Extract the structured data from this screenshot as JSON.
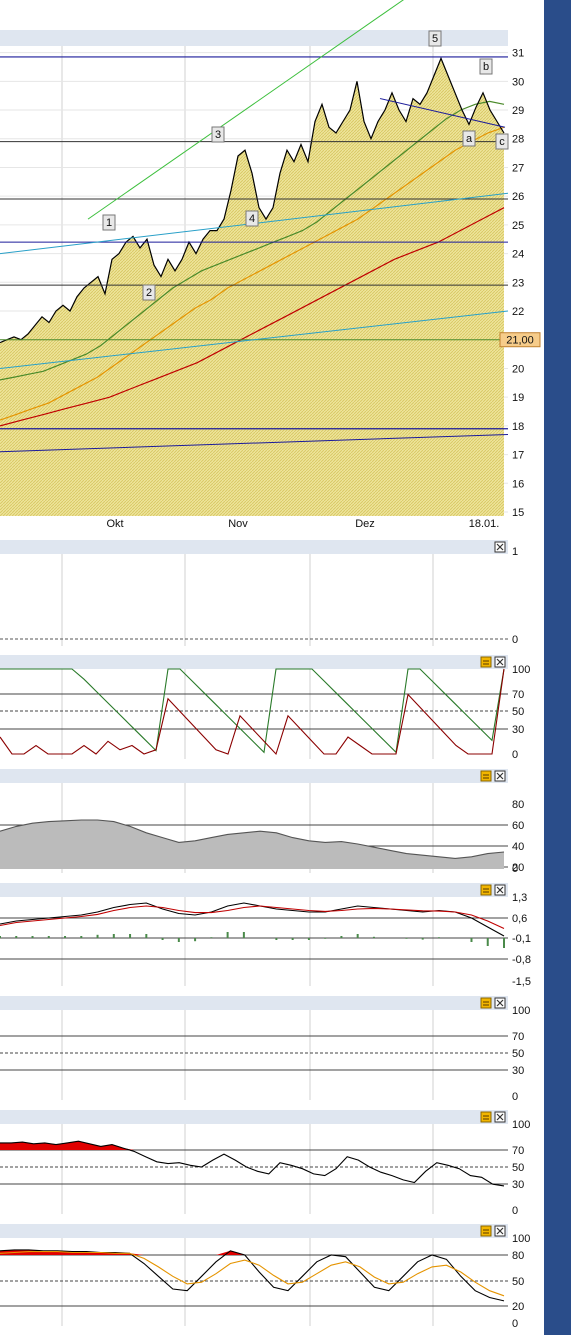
{
  "chart_data": [
    {
      "type": "line",
      "panel": "price",
      "x_labels": [
        "Okt",
        "Nov",
        "Dez",
        "18.01."
      ],
      "y_ticks": [
        15,
        16,
        17,
        18,
        19,
        20,
        21,
        22,
        23,
        24,
        25,
        26,
        27,
        28,
        29,
        30,
        31
      ],
      "ylim": [
        15,
        31.3
      ],
      "last_price_label": "21,00",
      "wave_labels": [
        "1",
        "2",
        "3",
        "4",
        "5",
        "a",
        "b",
        "c"
      ],
      "series": [
        {
          "values": [
            20.9,
            21.0,
            21.1,
            21.0,
            21.2,
            21.5,
            21.8,
            21.6,
            22.0,
            22.2,
            22.0,
            22.5,
            22.8,
            23.0,
            23.2,
            22.6,
            23.8,
            24.0,
            24.4,
            24.6,
            24.2,
            24.5,
            23.6,
            23.2,
            23.8,
            23.4,
            23.8,
            24.4,
            24.0,
            24.5,
            24.8,
            24.8,
            25.2,
            26.2,
            27.4,
            27.6,
            26.8,
            25.6,
            25.2,
            25.6,
            26.8,
            27.6,
            27.2,
            27.8,
            27.2,
            28.6,
            29.2,
            28.4,
            28.2,
            28.6,
            29.0,
            30.0,
            28.6,
            28.0,
            28.6,
            29.0,
            29.6,
            29.0,
            28.6,
            29.4,
            29.2,
            29.6,
            30.2,
            30.8,
            30.2,
            29.6,
            29.0,
            28.5,
            29.1,
            29.6,
            29.0,
            28.6,
            28.2
          ]
        },
        {
          "values": [
            19.6,
            19.7,
            19.8,
            19.9,
            20.1,
            20.3,
            20.5,
            20.8,
            21.2,
            21.6,
            22.0,
            22.4,
            22.8,
            23.1,
            23.4,
            23.6,
            23.8,
            24.0,
            24.2,
            24.4,
            24.6,
            24.8,
            25.1,
            25.5,
            25.9,
            26.3,
            26.7,
            27.1,
            27.5,
            27.9,
            28.3,
            28.7,
            29.0,
            29.2,
            29.3,
            29.2
          ]
        },
        {
          "values": [
            18.2,
            18.4,
            18.6,
            18.8,
            19.1,
            19.4,
            19.7,
            20.1,
            20.5,
            20.9,
            21.3,
            21.7,
            22.1,
            22.4,
            22.8,
            23.1,
            23.4,
            23.7,
            24.0,
            24.3,
            24.6,
            24.9,
            25.2,
            25.6,
            26.0,
            26.4,
            26.8,
            27.2,
            27.6,
            27.9,
            28.2,
            28.4
          ]
        },
        {
          "values": [
            18.0,
            18.2,
            18.4,
            18.6,
            18.8,
            19.0,
            19.3,
            19.6,
            19.9,
            20.2,
            20.6,
            21.0,
            21.4,
            21.8,
            22.2,
            22.6,
            23.0,
            23.4,
            23.8,
            24.1,
            24.4,
            24.8,
            25.2,
            25.6
          ]
        }
      ]
    },
    {
      "type": "line",
      "panel": "indicator-1",
      "y_ticks": [
        "1",
        "0"
      ]
    },
    {
      "type": "line",
      "panel": "indicator-2",
      "y_ticks": [
        "100",
        "70",
        "50",
        "30",
        "0"
      ],
      "series": [
        {
          "values": [
            100,
            100,
            100,
            100,
            100,
            100,
            100,
            88,
            74,
            60,
            46,
            32,
            18,
            4,
            100,
            100,
            86,
            72,
            58,
            44,
            30,
            16,
            2,
            100,
            100,
            100,
            100,
            86,
            72,
            58,
            44,
            30,
            16,
            2,
            100,
            100,
            86,
            72,
            58,
            44,
            30,
            16,
            100
          ]
        },
        {
          "values": [
            20,
            0,
            0,
            10,
            0,
            0,
            0,
            10,
            0,
            15,
            5,
            10,
            0,
            5,
            65,
            50,
            35,
            20,
            5,
            0,
            45,
            30,
            15,
            0,
            45,
            30,
            15,
            0,
            0,
            20,
            10,
            0,
            0,
            0,
            70,
            55,
            40,
            25,
            10,
            0,
            0,
            0,
            100
          ]
        }
      ]
    },
    {
      "type": "area",
      "panel": "indicator-3",
      "y_ticks": [
        "80",
        "60",
        "40",
        "20",
        "0"
      ],
      "series": [
        {
          "values": [
            46,
            52,
            56,
            58,
            59,
            60,
            60,
            58,
            52,
            44,
            38,
            32,
            34,
            38,
            42,
            44,
            46,
            44,
            38,
            34,
            32,
            33,
            30,
            26,
            22,
            18,
            16,
            14,
            12,
            14,
            18,
            20
          ]
        }
      ]
    },
    {
      "type": "line",
      "panel": "indicator-4",
      "y_ticks": [
        "1,3",
        "0,6",
        "-0,1",
        "-0,8",
        "-1,5"
      ],
      "series": [
        {
          "values": [
            0.4,
            0.5,
            0.55,
            0.6,
            0.65,
            0.7,
            0.8,
            0.95,
            1.05,
            1.1,
            0.9,
            0.75,
            0.7,
            0.8,
            1.0,
            1.1,
            1.0,
            0.9,
            0.85,
            0.8,
            0.8,
            0.9,
            1.0,
            0.95,
            0.9,
            0.85,
            0.8,
            0.85,
            0.8,
            0.6,
            0.3,
            0.0
          ]
        },
        {
          "values": [
            0.35,
            0.45,
            0.5,
            0.55,
            0.6,
            0.65,
            0.72,
            0.85,
            0.95,
            1.0,
            0.95,
            0.85,
            0.78,
            0.78,
            0.85,
            0.95,
            1.0,
            0.95,
            0.9,
            0.85,
            0.82,
            0.85,
            0.9,
            0.92,
            0.9,
            0.87,
            0.84,
            0.83,
            0.8,
            0.7,
            0.5,
            0.25
          ]
        }
      ]
    },
    {
      "type": "line",
      "panel": "indicator-5",
      "y_ticks": [
        "100",
        "70",
        "50",
        "30",
        "0"
      ]
    },
    {
      "type": "line",
      "panel": "indicator-6",
      "y_ticks": [
        "100",
        "70",
        "50",
        "30",
        "0"
      ],
      "series": [
        {
          "values": [
            78,
            78,
            79,
            77,
            78,
            76,
            78,
            80,
            77,
            74,
            76,
            72,
            68,
            62,
            56,
            54,
            55,
            52,
            50,
            58,
            65,
            58,
            50,
            45,
            42,
            55,
            52,
            48,
            42,
            40,
            48,
            62,
            58,
            50,
            44,
            40,
            35,
            32,
            45,
            55,
            52,
            48,
            40,
            38,
            30,
            28
          ]
        }
      ]
    },
    {
      "type": "line",
      "panel": "indicator-7",
      "y_ticks": [
        "100",
        "80",
        "50",
        "20",
        "0"
      ],
      "series": [
        {
          "values": [
            85,
            86,
            86,
            85,
            85,
            84,
            84,
            83,
            83,
            82,
            70,
            55,
            40,
            38,
            55,
            72,
            85,
            80,
            60,
            42,
            38,
            55,
            72,
            80,
            78,
            60,
            42,
            38,
            55,
            72,
            80,
            75,
            55,
            38,
            30,
            26
          ]
        },
        {
          "values": [
            82,
            83,
            84,
            84,
            84,
            83,
            83,
            83,
            82,
            82,
            76,
            66,
            55,
            46,
            48,
            58,
            70,
            74,
            68,
            56,
            46,
            48,
            58,
            68,
            72,
            66,
            54,
            46,
            48,
            58,
            66,
            68,
            60,
            48,
            38,
            32
          ]
        }
      ]
    }
  ]
}
